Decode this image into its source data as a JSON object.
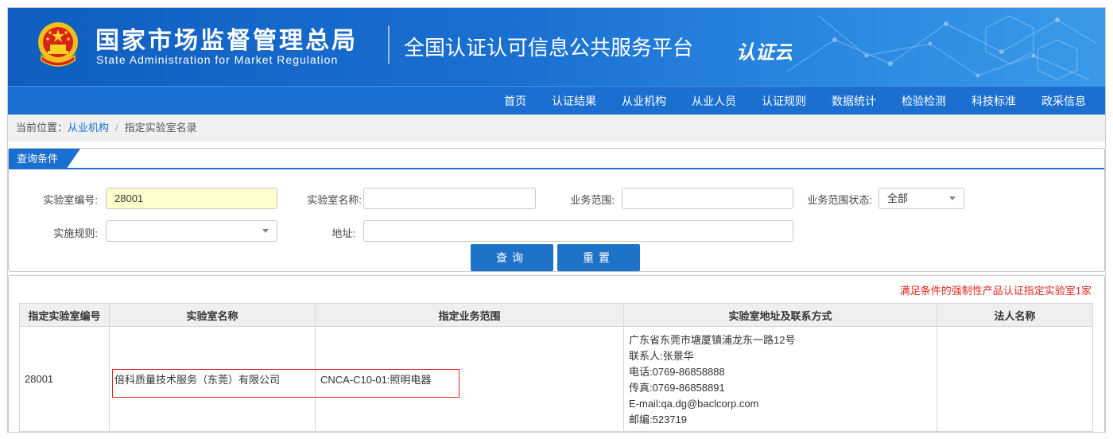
{
  "header": {
    "title_cn": "国家市场监督管理总局",
    "title_en": "State Administration  for  Market Regulation",
    "subtitle": "全国认证认可信息公共服务平台",
    "logo_text": "认证云"
  },
  "nav": {
    "items": [
      "首页",
      "认证结果",
      "从业机构",
      "从业人员",
      "认证规则",
      "数据统计",
      "检验检测",
      "科技标准",
      "政采信息"
    ]
  },
  "breadcrumb": {
    "prefix": "当前位置：",
    "parent": "从业机构",
    "separator": "/",
    "current": "指定实验室名录"
  },
  "query": {
    "tab_label": "查询条件",
    "lab_code_label": "实验室编号:",
    "lab_code_value": "28001",
    "lab_name_label": "实验室名称:",
    "lab_name_value": "",
    "scope_label": "业务范围:",
    "scope_value": "",
    "scope_status_label": "业务范围状态:",
    "scope_status_value": "全部",
    "rule_label": "实施规则:",
    "rule_value": "",
    "address_label": "地址:",
    "address_value": "",
    "search_button": "查询",
    "reset_button": "重置"
  },
  "results": {
    "count_note": "满足条件的强制性产品认证指定实验室1家",
    "columns": [
      "指定实验室编号",
      "实验室名称",
      "指定业务范围",
      "实验室地址及联系方式",
      "法人名称"
    ],
    "rows": [
      {
        "code": "28001",
        "name": "倍科质量技术服务（东莞）有限公司",
        "scope": "CNCA-C10-01:照明电器",
        "address_lines": [
          "广东省东莞市塘厦镇浦龙东一路12号",
          "联系人:张景华",
          "电话:0769-86858888",
          "传真:0769-86858891",
          "E-mail:qa.dg@baclcorp.com",
          "邮编:523719"
        ],
        "legal_name": ""
      }
    ]
  },
  "colors": {
    "primary": "#1a6fd0",
    "highlight_input": "#ffffcc",
    "alert_red": "#e0251d"
  }
}
